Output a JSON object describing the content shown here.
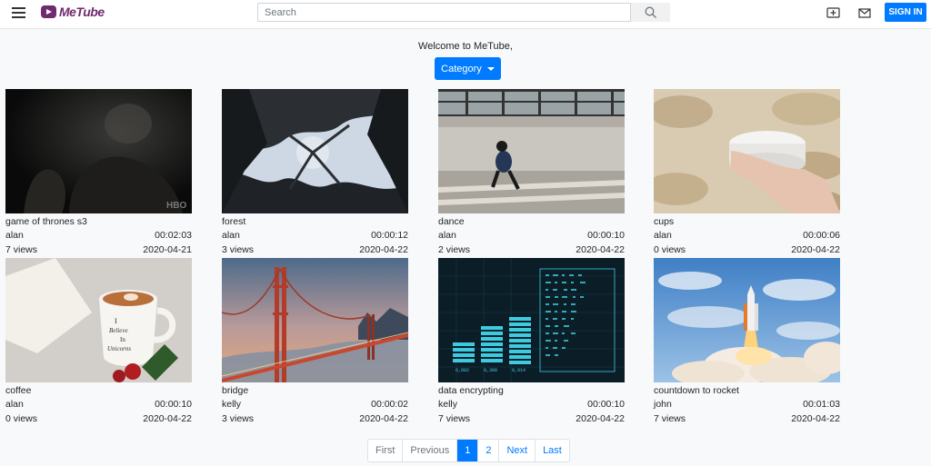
{
  "header": {
    "logo_text": "MeTube",
    "search_placeholder": "Search",
    "signin_label": "SIGN IN"
  },
  "welcome_text": "Welcome to MeTube,",
  "category_label": "Category",
  "videos": [
    {
      "title": "game of thrones s3",
      "author": "alan",
      "duration": "00:02:03",
      "views": "7 views",
      "date": "2020-04-21"
    },
    {
      "title": "forest",
      "author": "alan",
      "duration": "00:00:12",
      "views": "3 views",
      "date": "2020-04-22"
    },
    {
      "title": "dance",
      "author": "alan",
      "duration": "00:00:10",
      "views": "2 views",
      "date": "2020-04-22"
    },
    {
      "title": "cups",
      "author": "alan",
      "duration": "00:00:06",
      "views": "0 views",
      "date": "2020-04-22"
    },
    {
      "title": "coffee",
      "author": "alan",
      "duration": "00:00:10",
      "views": "0 views",
      "date": "2020-04-22"
    },
    {
      "title": "bridge",
      "author": "kelly",
      "duration": "00:00:02",
      "views": "3 views",
      "date": "2020-04-22"
    },
    {
      "title": "data encrypting",
      "author": "kelly",
      "duration": "00:00:10",
      "views": "7 views",
      "date": "2020-04-22"
    },
    {
      "title": "countdown to rocket",
      "author": "john",
      "duration": "00:01:03",
      "views": "7 views",
      "date": "2020-04-22"
    }
  ],
  "thumb_texts": {
    "hbo": "HBO",
    "mug": [
      "I",
      "Believe",
      "In",
      "Unicorns"
    ],
    "bars": [
      "6,082",
      "8,308",
      "8,914"
    ]
  },
  "pagination": [
    "First",
    "Previous",
    "1",
    "2",
    "Next",
    "Last"
  ],
  "colors": {
    "accent": "#007bff",
    "brand": "#6f2b6d"
  }
}
